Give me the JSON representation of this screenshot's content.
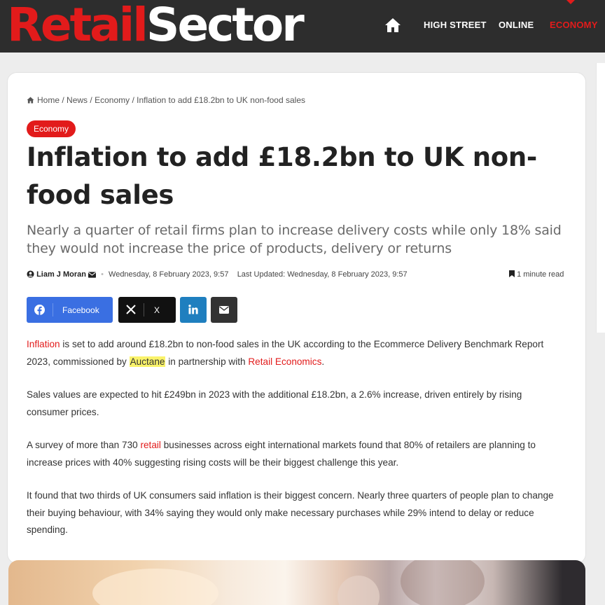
{
  "header": {
    "logo_part1": "Retail",
    "logo_part2": "Sector",
    "nav": [
      {
        "icon": "home-icon"
      },
      {
        "label": "HIGH STREET"
      },
      {
        "label": "ONLINE"
      },
      {
        "label": "ECONOMY",
        "active": true
      }
    ]
  },
  "breadcrumb": {
    "home": "Home",
    "sep": "/",
    "news": "News",
    "economy": "Economy",
    "current": "Inflation to add £18.2bn to UK non-food sales"
  },
  "article": {
    "category": "Economy",
    "title": "Inflation to add £18.2bn to UK non-food sales",
    "subtitle": "Nearly a quarter of retail firms plan to increase delivery costs while only 18% said they would not increase the price of products, delivery or returns",
    "author": "Liam J Moran",
    "published": "Wednesday, 8 February 2023, 9:57",
    "updated": "Last Updated: Wednesday, 8 February 2023, 9:57",
    "read_time": "1 minute read",
    "share": {
      "facebook": "Facebook",
      "x": "X"
    },
    "p1": {
      "link1": "Inflation",
      "t1": " is set to add around £18.2bn to non-food sales in the UK according to the Ecommerce Delivery Benchmark Report 2023, commissioned by ",
      "highlight": "Auctane",
      "t2": " in partnership with ",
      "link2": "Retail Economics",
      "t3": "."
    },
    "p2": "Sales values are expected to hit £249bn in 2023 with the additional £18.2bn, a 2.6% increase, driven entirely by rising consumer prices.",
    "p3": {
      "t1": "A survey of more than 730 ",
      "link": "retail",
      "t2": " businesses across eight international markets found that 80% of retailers are planning to increase prices with 40% suggesting rising costs will be their biggest challenge this year."
    },
    "p4": "It found that two thirds of UK consumers said inflation is their biggest concern. Nearly three quarters of people plan to change their buying behaviour, with 34% saying they would only make necessary purchases while 29% intend to delay or reduce spending."
  },
  "colors": {
    "brand_red": "#e21b1b",
    "header_bg": "#2d2d2d",
    "facebook": "#3a6fe2",
    "linkedin": "#1f7fbf",
    "highlight": "#faf36a"
  }
}
